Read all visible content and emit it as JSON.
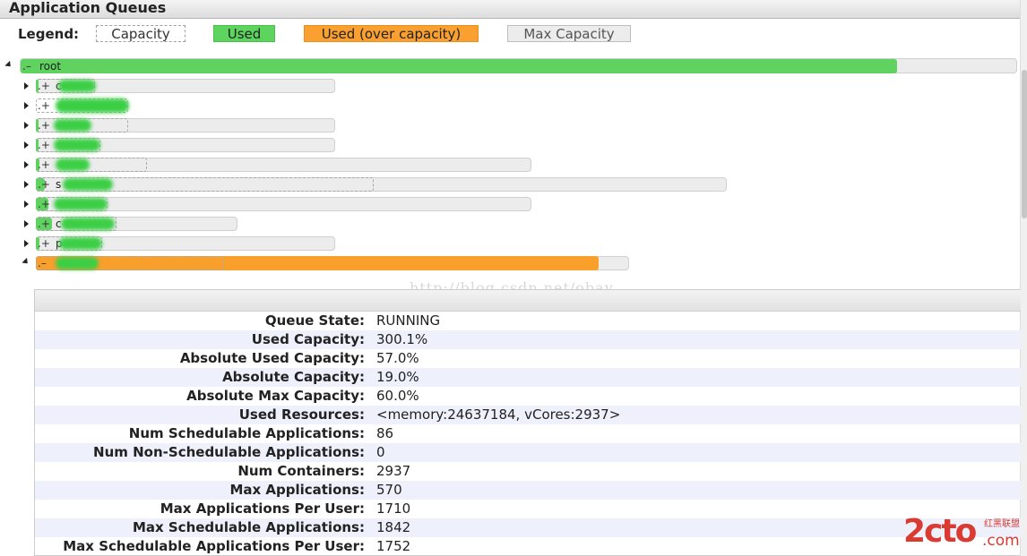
{
  "header": {
    "title": "Application Queues"
  },
  "legend": {
    "label": "Legend:",
    "capacity": "Capacity",
    "used": "Used",
    "over": "Used (over capacity)",
    "max": "Max Capacity",
    "colors": {
      "used": "#5fd25f",
      "over": "#f9a02c",
      "max": "#ececec"
    }
  },
  "tree": {
    "root": {
      "toggle": ".–",
      "name": "root",
      "used_fraction": 0.87
    },
    "children": [
      {
        "toggle": ".+",
        "partial_name": "c"
      },
      {
        "toggle": ".+",
        "partial_name": ""
      },
      {
        "toggle": ".+",
        "partial_name": ""
      },
      {
        "toggle": ".+",
        "partial_name": ""
      },
      {
        "toggle": ".+",
        "partial_name": ""
      },
      {
        "toggle": ".+",
        "partial_name": "s"
      },
      {
        "toggle": ".+",
        "partial_name": ""
      },
      {
        "toggle": ".+",
        "partial_name": "c"
      },
      {
        "toggle": ".+",
        "partial_name": "p"
      },
      {
        "toggle": ".–",
        "partial_name": ""
      }
    ]
  },
  "watermark": "http://blog.csdn.net/obay",
  "queue_info": [
    {
      "key": "Queue State:",
      "value": "RUNNING"
    },
    {
      "key": "Used Capacity:",
      "value": "300.1%"
    },
    {
      "key": "Absolute Used Capacity:",
      "value": "57.0%"
    },
    {
      "key": "Absolute Capacity:",
      "value": "19.0%"
    },
    {
      "key": "Absolute Max Capacity:",
      "value": "60.0%"
    },
    {
      "key": "Used Resources:",
      "value": "<memory:24637184, vCores:2937>"
    },
    {
      "key": "Num Schedulable Applications:",
      "value": "86"
    },
    {
      "key": "Num Non-Schedulable Applications:",
      "value": "0"
    },
    {
      "key": "Num Containers:",
      "value": "2937"
    },
    {
      "key": "Max Applications:",
      "value": "570"
    },
    {
      "key": "Max Applications Per User:",
      "value": "1710"
    },
    {
      "key": "Max Schedulable Applications:",
      "value": "1842"
    },
    {
      "key": "Max Schedulable Applications Per User:",
      "value": "1752"
    }
  ],
  "logo": {
    "main": "2cto",
    "cn": "红黑联盟",
    "suffix": ".com"
  }
}
